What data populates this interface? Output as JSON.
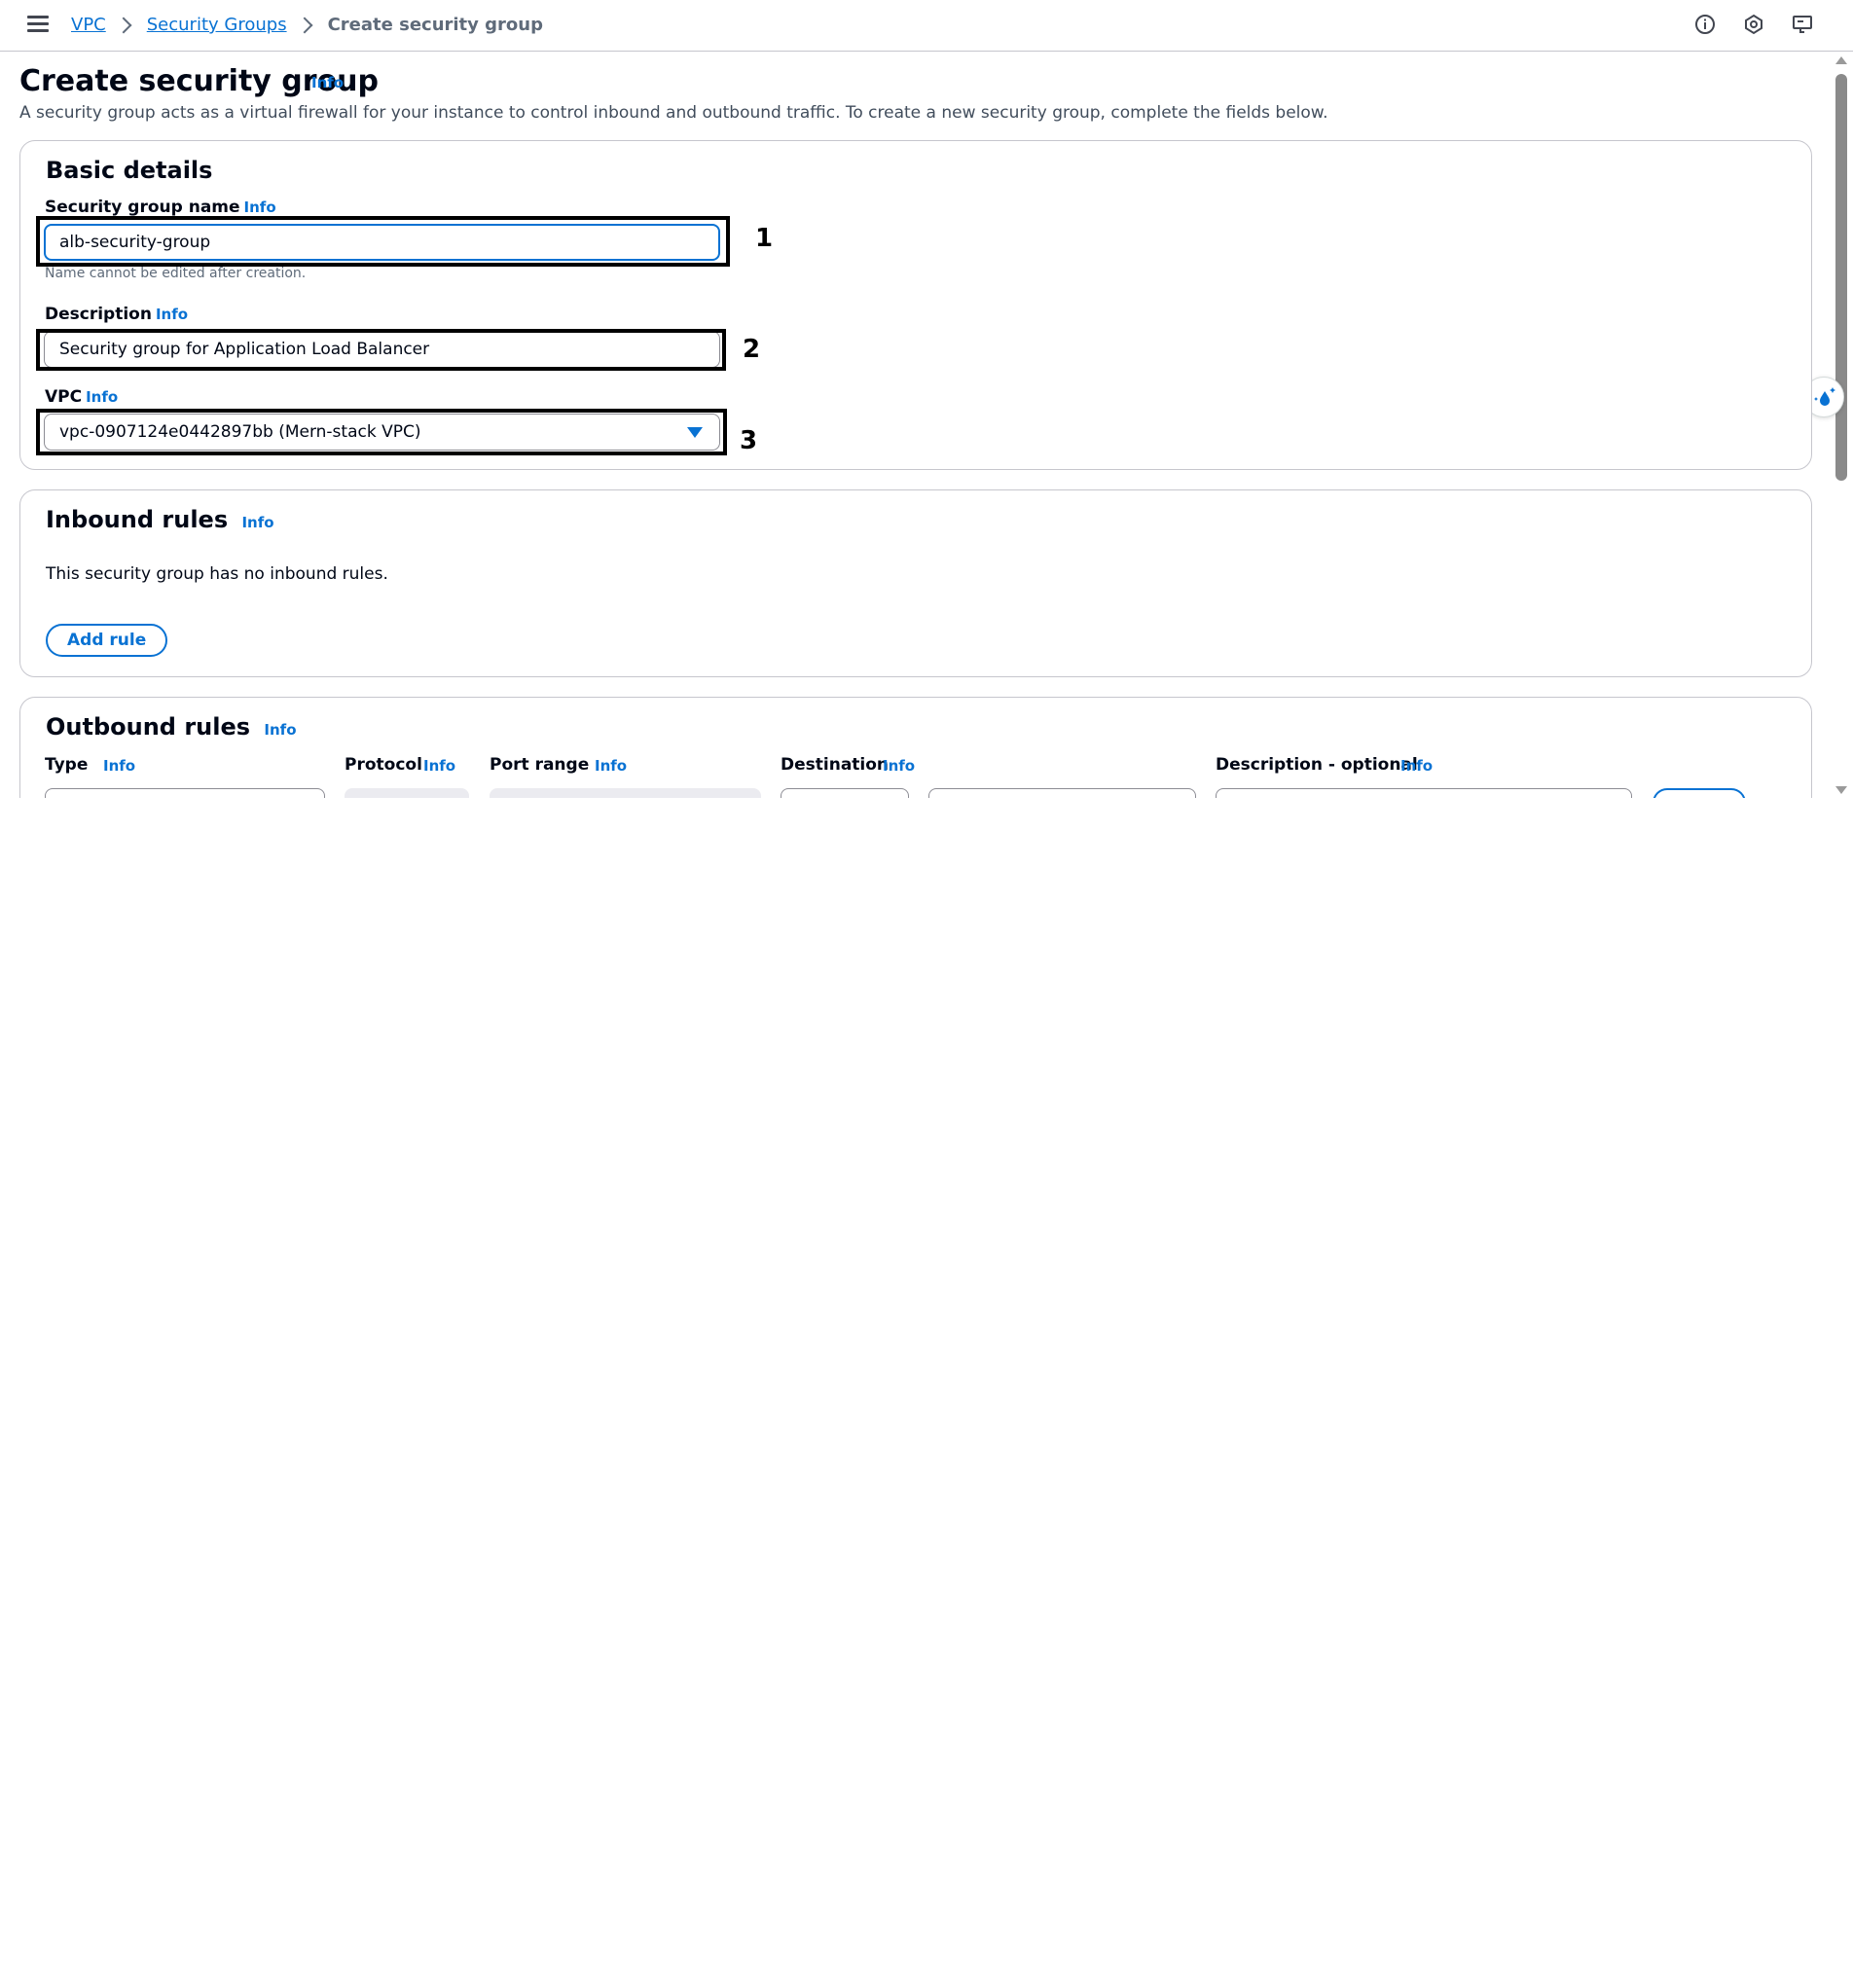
{
  "breadcrumb": {
    "items": [
      "VPC",
      "Security Groups"
    ],
    "current": "Create security group"
  },
  "icons": {
    "menu": "hamburger-menu-icon",
    "info": "info-circle-icon",
    "notifications": "settings-gear-icon",
    "feedback": "feedback-screen-icon",
    "assistant": "ai-assistant-icon"
  },
  "page": {
    "title": "Create security group",
    "title_info": "Info",
    "description": "A security group acts as a virtual firewall for your instance to control inbound and outbound traffic. To create a new security group, complete the fields below."
  },
  "basic_details": {
    "heading": "Basic details",
    "name_label": "Security group name",
    "name_info": "Info",
    "name_value": "alb-security-group",
    "name_hint": "Name cannot be edited after creation.",
    "description_label": "Description",
    "description_info": "Info",
    "description_value": "Security group for Application Load Balancer",
    "vpc_label": "VPC",
    "vpc_info": "Info",
    "vpc_value": "vpc-0907124e0442897bb (Mern-stack VPC)"
  },
  "annotations": [
    "1",
    "2",
    "3"
  ],
  "inbound": {
    "heading": "Inbound rules",
    "info": "Info",
    "empty_text": "This security group has no inbound rules.",
    "add_button": "Add rule"
  },
  "outbound": {
    "heading": "Outbound rules",
    "info": "Info",
    "columns": [
      {
        "label": "Type",
        "info": "Info"
      },
      {
        "label": "Protocol",
        "info": "Info"
      },
      {
        "label": "Port range",
        "info": "Info"
      },
      {
        "label": "Destination",
        "info": "Info"
      },
      {
        "label": "Description - optional",
        "info": "Info"
      }
    ]
  },
  "colors": {
    "link": "#0972d3",
    "text": "#000716",
    "border": "#c6c6cd"
  }
}
